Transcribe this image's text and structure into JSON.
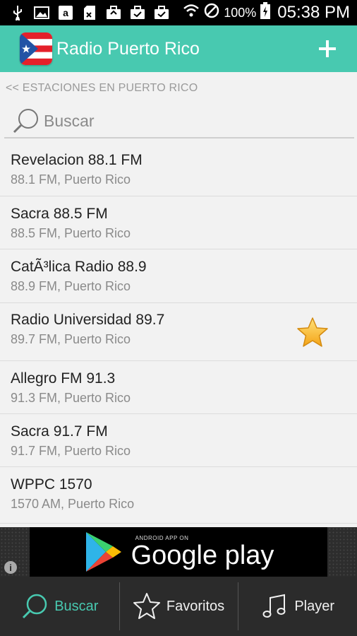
{
  "status_bar": {
    "battery_percent": "100%",
    "time": "05:38 PM",
    "icons": [
      "usb-icon",
      "image-icon",
      "amazon-icon",
      "sd-card-icon",
      "briefcase-icon",
      "briefcase-check-icon",
      "briefcase-check-icon",
      "wifi-icon",
      "no-signal-icon",
      "battery-charging-icon"
    ]
  },
  "app_bar": {
    "title": "Radio Puerto Rico",
    "flag_icon": "puerto-rico-flag-icon",
    "add_icon": "plus-icon",
    "accent_color": "#48c9b0"
  },
  "back_link": "<< ESTACIONES EN PUERTO RICO",
  "search": {
    "placeholder": "Buscar",
    "value": ""
  },
  "stations": [
    {
      "name": "Revelacion 88.1 FM",
      "subtitle": "88.1 FM, Puerto Rico",
      "favorite": false
    },
    {
      "name": "Sacra 88.5 FM",
      "subtitle": "88.5 FM, Puerto Rico",
      "favorite": false
    },
    {
      "name": "CatÃ³lica Radio 88.9",
      "subtitle": "88.9 FM, Puerto Rico",
      "favorite": false
    },
    {
      "name": "Radio Universidad 89.7",
      "subtitle": "89.7 FM, Puerto Rico",
      "favorite": true
    },
    {
      "name": "Allegro FM 91.3",
      "subtitle": "91.3 FM, Puerto Rico",
      "favorite": false
    },
    {
      "name": "Sacra 91.7 FM",
      "subtitle": "91.7 FM, Puerto Rico",
      "favorite": false
    },
    {
      "name": "WPPC 1570",
      "subtitle": "1570 AM, Puerto Rico",
      "favorite": false
    }
  ],
  "ad": {
    "top_text": "ANDROID APP ON",
    "main_text": "Google play",
    "info_icon": "info-icon"
  },
  "bottom_nav": {
    "items": [
      {
        "label": "Buscar",
        "icon": "search-icon",
        "active": true
      },
      {
        "label": "Favoritos",
        "icon": "star-outline-icon",
        "active": false
      },
      {
        "label": "Player",
        "icon": "music-note-icon",
        "active": false
      }
    ]
  }
}
